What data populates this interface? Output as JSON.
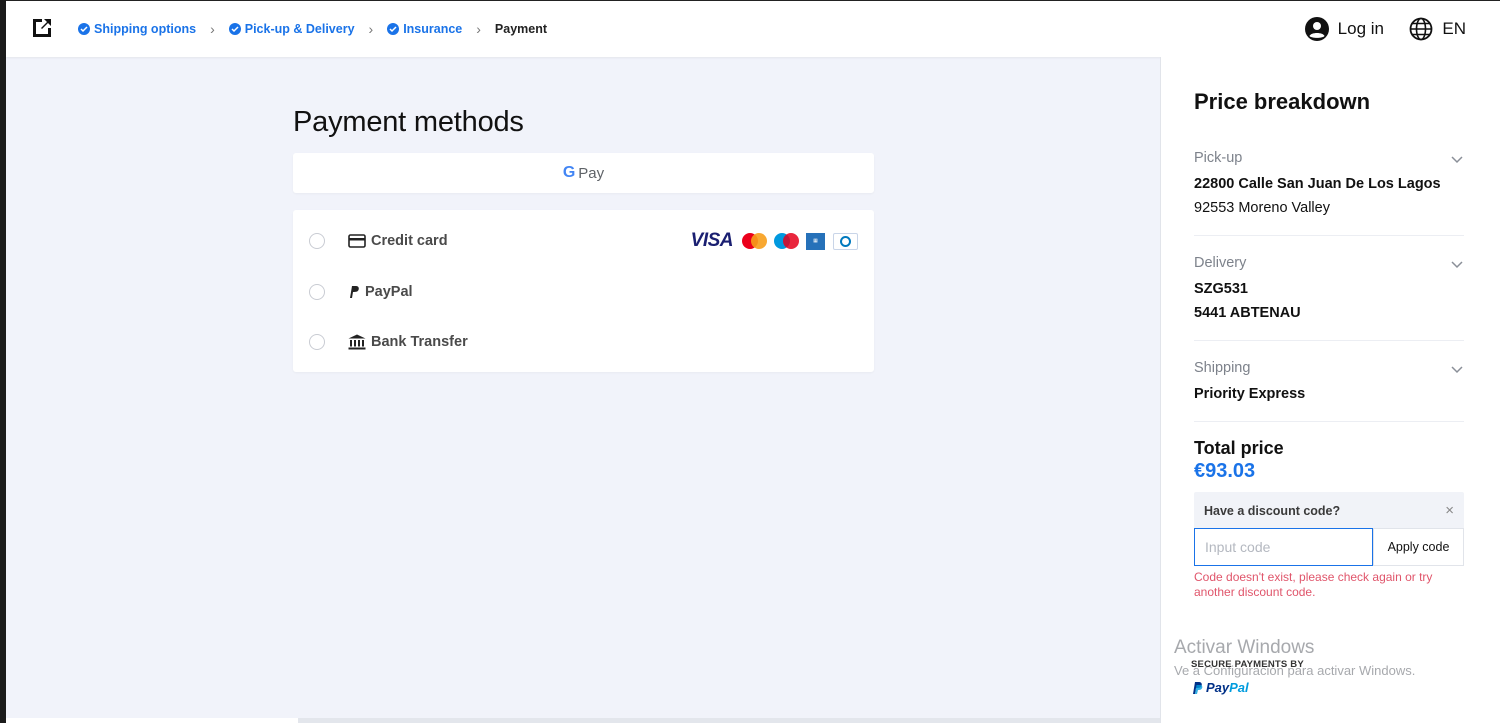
{
  "header": {
    "steps": [
      {
        "label": "Shipping options",
        "done": true
      },
      {
        "label": "Pick-up & Delivery",
        "done": true
      },
      {
        "label": "Insurance",
        "done": true
      },
      {
        "label": "Payment",
        "done": false
      }
    ],
    "login_label": "Log in",
    "language": "EN",
    "icons": {
      "logo": "external-link-icon",
      "login": "user-circle-icon",
      "language": "globe-icon"
    }
  },
  "main": {
    "title": "Payment methods",
    "gpay_label": "Pay",
    "gpay_g": "G",
    "methods": [
      {
        "label": "Credit card",
        "icon": "credit-card-icon"
      },
      {
        "label": "PayPal",
        "icon": "paypal-icon"
      },
      {
        "label": "Bank Transfer",
        "icon": "bank-icon"
      }
    ],
    "card_brands": {
      "visa": "VISA",
      "icons": [
        "mastercard-icon",
        "maestro-icon",
        "amex-icon",
        "diners-icon"
      ]
    }
  },
  "sidebar": {
    "title": "Price breakdown",
    "pickup": {
      "title": "Pick-up",
      "line1": "22800 Calle San Juan De Los Lagos",
      "line2": "92553 Moreno Valley"
    },
    "delivery": {
      "title": "Delivery",
      "line1": "SZG531",
      "line2": "5441 ABTENAU"
    },
    "shipping": {
      "title": "Shipping",
      "line1": "Priority Express"
    },
    "total_label": "Total price",
    "total_value": "€93.03",
    "discount": {
      "title": "Have a discount code?",
      "close": "×",
      "placeholder": "Input code",
      "value": "",
      "apply_label": "Apply code",
      "error": "Code doesn't exist, please check again or try another discount code."
    },
    "secure_label": "SECURE PAYMENTS BY",
    "paypal_logo_1": "Pay",
    "paypal_logo_2": "Pal"
  },
  "overlay": {
    "watermark_line1": "Activar Windows",
    "watermark_line2": "Ve a Configuración para activar Windows."
  },
  "colors": {
    "accent": "#1a73e8",
    "error": "#e0556b",
    "background": "#f1f3fa"
  }
}
